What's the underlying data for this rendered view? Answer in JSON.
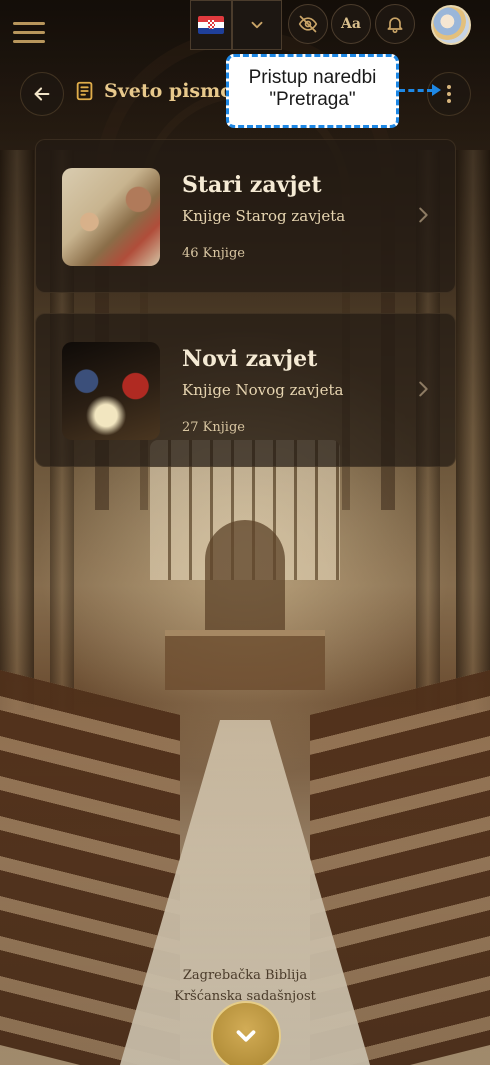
{
  "topbar": {
    "language_flag": "croatia-flag",
    "language_chevron": "chevron-down-icon",
    "visibility_icon": "eye-off-icon",
    "font_size_label": "Aa",
    "notifications_icon": "bell-icon",
    "avatar": "profile-avatar"
  },
  "header": {
    "back_icon": "arrow-left-icon",
    "section_icon": "book-icon",
    "section_title": "Sveto pismo",
    "more_icon": "more-vertical-icon"
  },
  "callout": {
    "line1": "Pristup naredbi",
    "line2": "\"Pretraga\""
  },
  "books": [
    {
      "title": "Stari zavjet",
      "subtitle": "Knjige Starog zavjeta",
      "count": "46 Knjige"
    },
    {
      "title": "Novi zavjet",
      "subtitle": "Knjige Novog zavjeta",
      "count": "27 Knjige"
    }
  ],
  "footer": {
    "line1": "Zagrebačka Biblija",
    "line2": "Kršćanska sadašnjost",
    "scroll_icon": "chevron-down-icon"
  },
  "colors": {
    "accent_gold": "#c9a467",
    "callout_blue": "#1e88e5",
    "card_bg": "#221a13",
    "scroll_button": "#c29d48"
  }
}
